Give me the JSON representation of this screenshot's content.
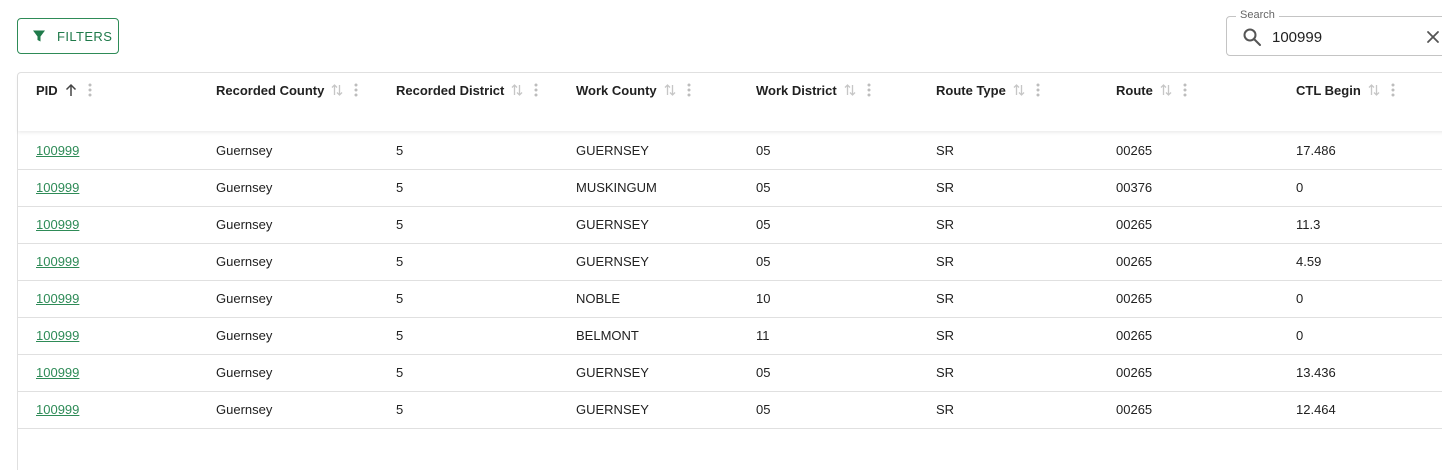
{
  "toolbar": {
    "filters_label": "FILTERS",
    "filter_icon": "filter-icon"
  },
  "search": {
    "label": "Search",
    "value": "100999",
    "search_icon": "search-icon",
    "clear_icon": "close-icon"
  },
  "colors": {
    "accent": "#2e8b57",
    "border": "#e0e0e0"
  },
  "table": {
    "columns": [
      {
        "label": "PID",
        "sort": "ascending"
      },
      {
        "label": "Recorded County",
        "sort": "none"
      },
      {
        "label": "Recorded District",
        "sort": "none"
      },
      {
        "label": "Work County",
        "sort": "none"
      },
      {
        "label": "Work District",
        "sort": "none"
      },
      {
        "label": "Route Type",
        "sort": "none"
      },
      {
        "label": "Route",
        "sort": "none"
      },
      {
        "label": "CTL Begin",
        "sort": "none"
      }
    ],
    "rows": [
      [
        "100999",
        "Guernsey",
        "5",
        "GUERNSEY",
        "05",
        "SR",
        "00265",
        "17.486"
      ],
      [
        "100999",
        "Guernsey",
        "5",
        "MUSKINGUM",
        "05",
        "SR",
        "00376",
        "0"
      ],
      [
        "100999",
        "Guernsey",
        "5",
        "GUERNSEY",
        "05",
        "SR",
        "00265",
        "11.3"
      ],
      [
        "100999",
        "Guernsey",
        "5",
        "GUERNSEY",
        "05",
        "SR",
        "00265",
        "4.59"
      ],
      [
        "100999",
        "Guernsey",
        "5",
        "NOBLE",
        "10",
        "SR",
        "00265",
        "0"
      ],
      [
        "100999",
        "Guernsey",
        "5",
        "BELMONT",
        "11",
        "SR",
        "00265",
        "0"
      ],
      [
        "100999",
        "Guernsey",
        "5",
        "GUERNSEY",
        "05",
        "SR",
        "00265",
        "13.436"
      ],
      [
        "100999",
        "Guernsey",
        "5",
        "GUERNSEY",
        "05",
        "SR",
        "00265",
        "12.464"
      ]
    ]
  }
}
